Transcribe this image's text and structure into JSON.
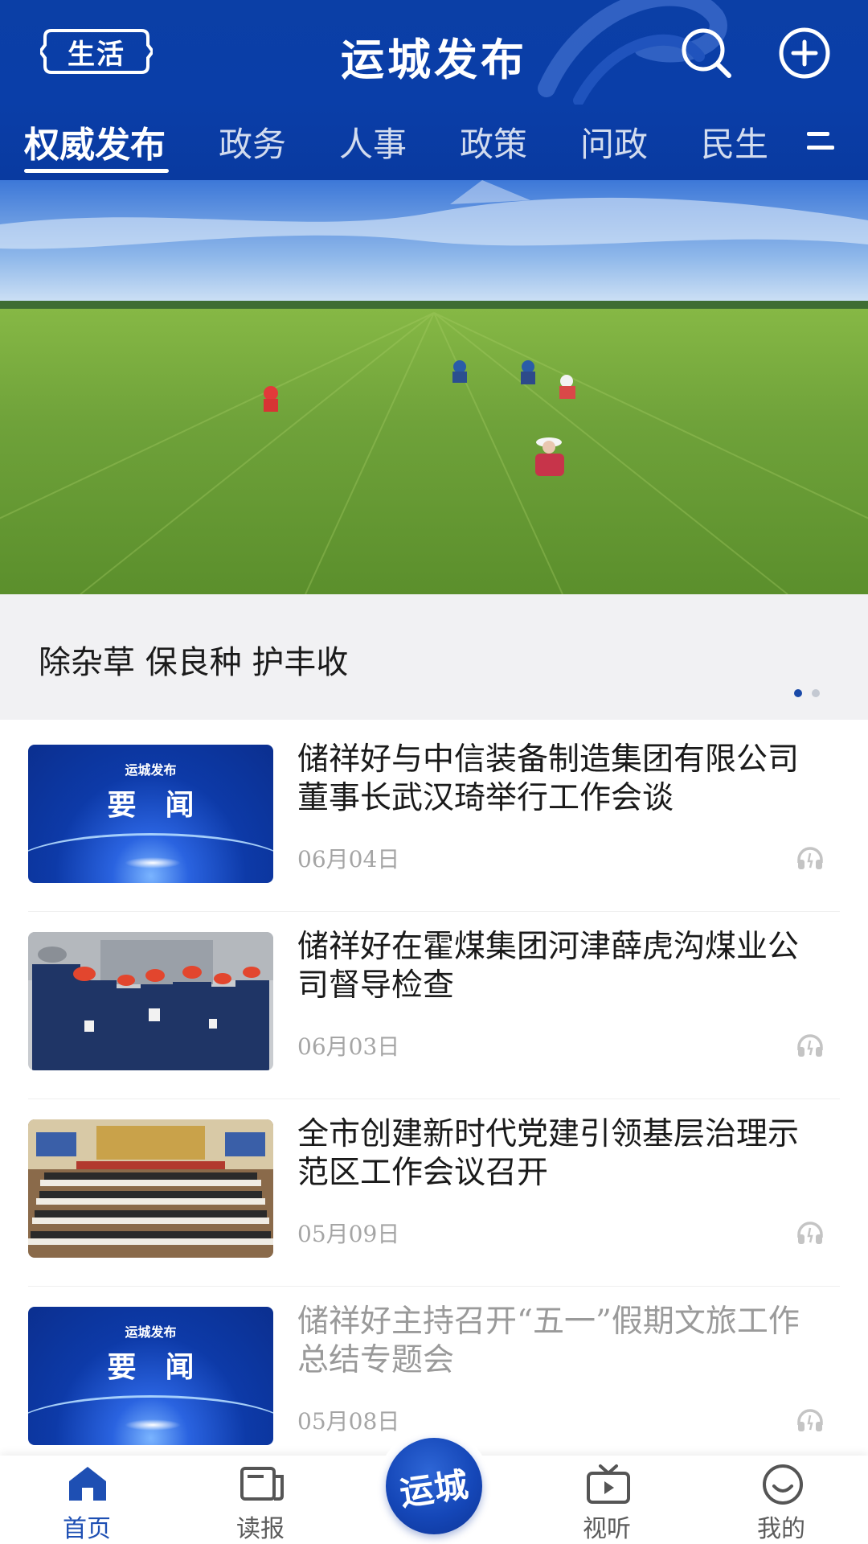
{
  "header": {
    "life_label": "生活",
    "title": "运城发布"
  },
  "tabs": [
    {
      "label": "权威发布",
      "active": true
    },
    {
      "label": "政务"
    },
    {
      "label": "人事"
    },
    {
      "label": "政策"
    },
    {
      "label": "问政"
    },
    {
      "label": "民生"
    }
  ],
  "banner": {
    "caption": "除杂草 保良种 护丰收",
    "slide_count": 2,
    "active_slide": 1
  },
  "news": [
    {
      "title": "储祥好与中信装备制造集团有限公司董事长武汉琦举行工作会谈",
      "date": "06月04日",
      "thumb": "brand"
    },
    {
      "title": "储祥好在霍煤集团河津薛虎沟煤业公司督导检查",
      "date": "06月03日",
      "thumb": "workers"
    },
    {
      "title": "全市创建新时代党建引领基层治理示范区工作会议召开",
      "date": "05月09日",
      "thumb": "meeting"
    },
    {
      "title": "储祥好主持召开“五一”假期文旅工作总结专题会",
      "date": "05月08日",
      "thumb": "brand"
    }
  ],
  "thumb_brand": {
    "small": "运城发布",
    "big": "要闻"
  },
  "bottom_nav": [
    {
      "label": "首页",
      "icon": "home-icon",
      "active": true
    },
    {
      "label": "读报",
      "icon": "newspaper-icon"
    },
    {
      "label": "运城",
      "icon": "center-logo"
    },
    {
      "label": "视听",
      "icon": "tv-icon"
    },
    {
      "label": "我的",
      "icon": "smile-icon"
    }
  ],
  "colors": {
    "brand_blue": "#0b3fa6",
    "accent_blue": "#1e4fb3"
  }
}
